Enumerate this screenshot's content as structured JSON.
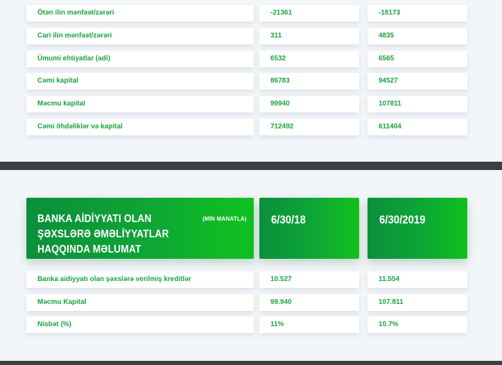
{
  "financial_table": {
    "rows": [
      {
        "label": "Ötən ilin mənfəət/zərəri",
        "v1": "-21361",
        "v2": "-18173"
      },
      {
        "label": "Cari ilin mənfəət/zərəri",
        "v1": "311",
        "v2": "4835"
      },
      {
        "label": "Ümumi ehtiyatlar (adi)",
        "v1": "6532",
        "v2": "6565"
      },
      {
        "label": "Cəmi kapital",
        "v1": "86783",
        "v2": "94527"
      },
      {
        "label": "Məcmu kapital",
        "v1": "99940",
        "v2": "107811"
      },
      {
        "label": "Cəmi öhdəliklər və kapital",
        "v1": "712492",
        "v2": "611404"
      }
    ]
  },
  "related_parties": {
    "title": "BANKA AİDİYYATI OLAN ŞƏXSLƏRƏ ƏMƏLİYYATLAR HAQQINDA MƏLUMAT",
    "unit": "(MİN MANATLA)",
    "date1": "6/30/18",
    "date2": "6/30/2019",
    "rows": [
      {
        "label": "Banka aidiyyatı olan şəxslərə verilmiş kreditlər",
        "v1": "10.527",
        "v2": "11.554"
      },
      {
        "label": "Məcmu Kapital",
        "v1": "99.940",
        "v2": "107.811"
      },
      {
        "label": "Nisbət (%)",
        "v1": "11%",
        "v2": "10.7%"
      }
    ]
  },
  "colors": {
    "accent_green": "#1aa43f",
    "header_gradient_start": "#0b8f3c",
    "header_gradient_end": "#0fc21e",
    "divider": "#3c3f42",
    "background": "#f3f6f9"
  }
}
